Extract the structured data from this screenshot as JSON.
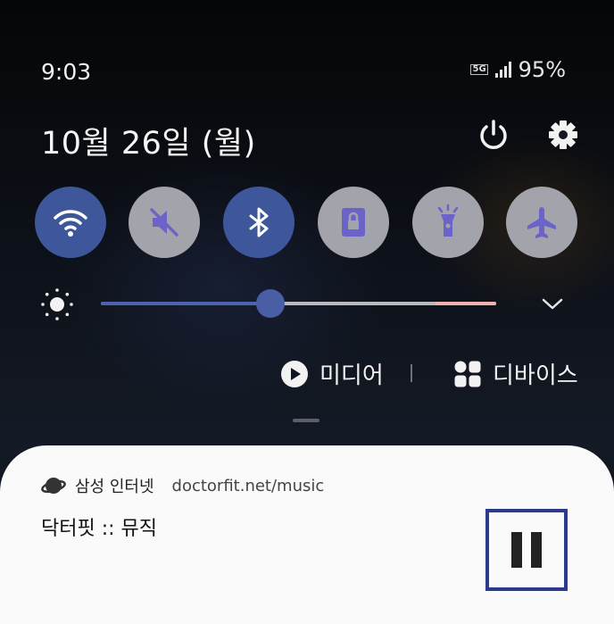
{
  "status_bar": {
    "time": "9:03",
    "network": "5G",
    "battery": "95%",
    "icons": [
      "5g-icon",
      "signal-icon"
    ]
  },
  "header": {
    "date": "10월 26일 (월)",
    "icons": [
      "power-icon",
      "gear-icon"
    ]
  },
  "quick_settings": [
    {
      "name": "wifi",
      "icon": "wifi-icon",
      "on": true
    },
    {
      "name": "sound",
      "icon": "mute-icon",
      "on": false
    },
    {
      "name": "bluetooth",
      "icon": "bluetooth-icon",
      "on": true
    },
    {
      "name": "lock",
      "icon": "lock-icon",
      "on": false
    },
    {
      "name": "flashlight",
      "icon": "flashlight-icon",
      "on": false
    },
    {
      "name": "airplane",
      "icon": "airplane-icon",
      "on": false
    }
  ],
  "brightness": {
    "level": 0.43,
    "icon": "sun-icon"
  },
  "media_controls": {
    "media_label": "미디어",
    "devices_label": "디바이스"
  },
  "notification": {
    "app_name": "삼성 인터넷",
    "url": "doctorfit.net/music",
    "title": "닥터핏 :: 뮤직",
    "icons": [
      "samsung-internet-icon",
      "pause-icon"
    ]
  },
  "colors": {
    "accent": "#3e569a",
    "tile_off": "#a3a4ab",
    "tile_icon_off": "#6b63c7",
    "highlight_border": "#2c3a8c"
  }
}
